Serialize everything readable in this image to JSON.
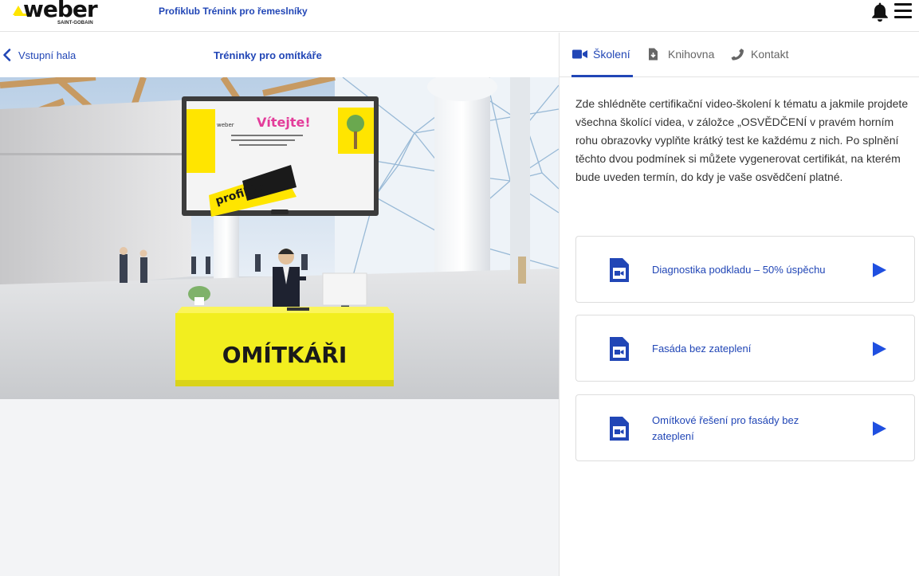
{
  "header": {
    "logo_text": "weber",
    "logo_sub": "SAINT-GOBAIN",
    "app_title": "Profiklub Trénink pro řemeslníky"
  },
  "subheader": {
    "back_label": "Vstupní hala",
    "page_title": "Tréninky pro omítkáře"
  },
  "scene": {
    "screen_text": "Vítejte!",
    "screen_brand": "weber",
    "screen_logo": "profiklub",
    "desk_label": "OMÍTKÁŘI"
  },
  "tabs": [
    {
      "label": "Školení",
      "icon": "video-camera-icon",
      "active": true
    },
    {
      "label": "Knihovna",
      "icon": "document-download-icon",
      "active": false
    },
    {
      "label": "Kontakt",
      "icon": "phone-icon",
      "active": false
    }
  ],
  "intro_text": "Zde shlédněte certifikační video-školení k tématu a jakmile projdete všechna školící videa, v záložce „OSVĚDČENÍ v pravém horním rohu obrazovky vyplňte krátký test ke každému z nich. Po splnění těchto dvou podmínek si můžete vygenerovat certifikát, na kterém bude uveden termín, do kdy je vaše osvědčení platné.",
  "courses": [
    {
      "label": "Diagnostika podkladu – 50% úspěchu"
    },
    {
      "label": "Fasáda bez zateplení"
    },
    {
      "label": "Omítkové řešení pro fasády bez zateplení"
    }
  ],
  "colors": {
    "brand_blue": "#2146b6",
    "brand_yellow": "#ffe500",
    "desk_yellow": "#f2ee1f",
    "accent_play": "#1f4fe0"
  }
}
